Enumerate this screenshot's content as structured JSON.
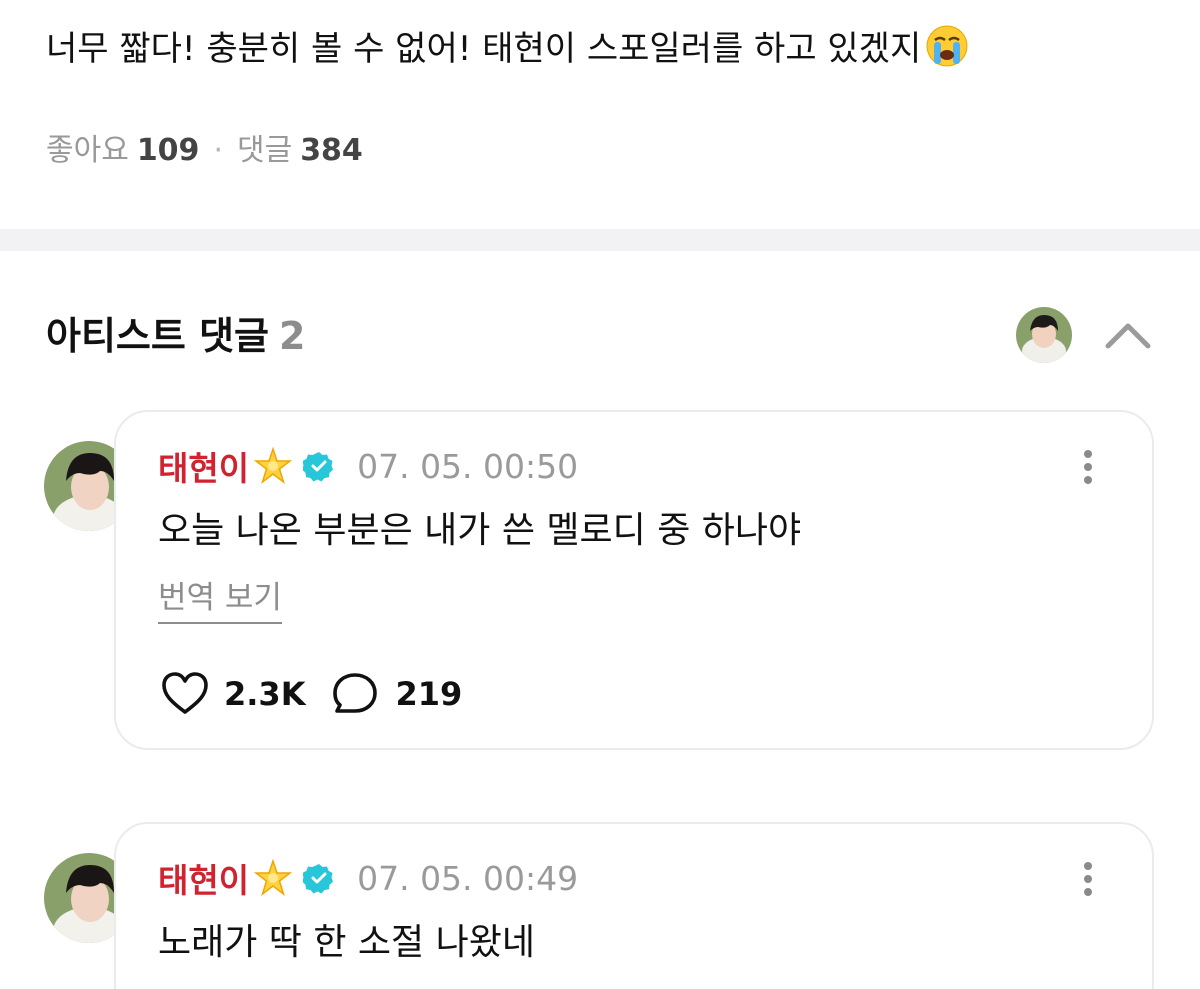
{
  "post": {
    "text": "너무 짧다! 충분히 볼 수 없어! 태현이 스포일러를 하고 있겠지",
    "emoji": "loudly-crying-face",
    "likes_label": "좋아요",
    "likes_count": "109",
    "separator": "·",
    "comments_label": "댓글",
    "comments_count": "384"
  },
  "artist_comments": {
    "title": "아티스트 댓글",
    "count": "2"
  },
  "comments": [
    {
      "author": "태현이",
      "time": "07. 05. 00:50",
      "text": "오늘 나온 부분은 내가 쓴 멜로디 중 하나야",
      "translate_label": "번역 보기",
      "likes": "2.3K",
      "replies": "219"
    },
    {
      "author": "태현이",
      "time": "07. 05. 00:49",
      "text": "노래가 딱 한 소절 나왔네"
    }
  ],
  "colors": {
    "author": "#d0232f",
    "verified": "#27c7d9",
    "muted": "#9a9a9a",
    "divider": "#f2f2f4"
  }
}
